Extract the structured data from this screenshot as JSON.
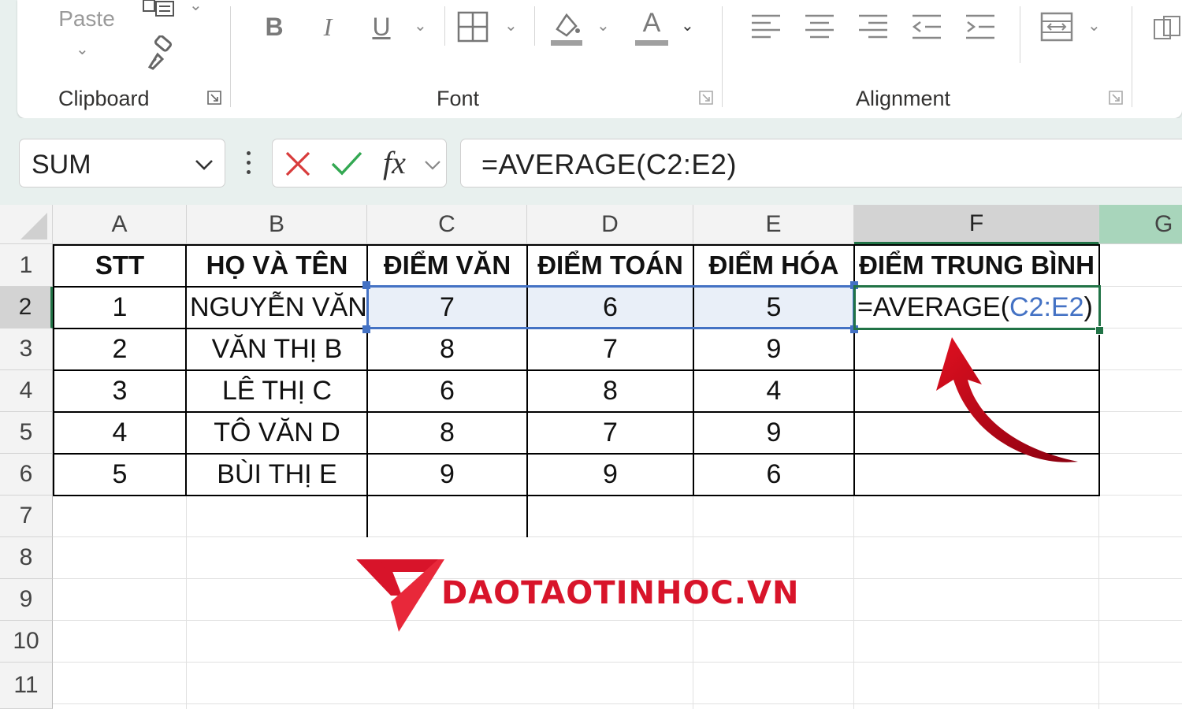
{
  "ribbon": {
    "paste_label": "Paste",
    "groups": {
      "clipboard": "Clipboard",
      "font": "Font",
      "alignment": "Alignment"
    },
    "font_buttons": {
      "bold": "B",
      "italic": "I",
      "underline": "U",
      "font_color": "A"
    }
  },
  "formula_bar": {
    "name_box": "SUM",
    "fx_label": "fx",
    "formula": "=AVERAGE(C2:E2)"
  },
  "columns": [
    "A",
    "B",
    "C",
    "D",
    "E",
    "F",
    "G"
  ],
  "rows": [
    "1",
    "2",
    "3",
    "4",
    "5",
    "6",
    "7",
    "8",
    "9",
    "10",
    "11"
  ],
  "table": {
    "headers": [
      "STT",
      "HỌ VÀ TÊN",
      "ĐIỂM VĂN",
      "ĐIỂM TOÁN",
      "ĐIỂM HÓA",
      "ĐIỂM TRUNG BÌNH"
    ],
    "rows": [
      [
        "1",
        "NGUYỄN VĂN",
        "7",
        "6",
        "5"
      ],
      [
        "2",
        "VĂN THỊ B",
        "8",
        "7",
        "9"
      ],
      [
        "3",
        "LÊ THỊ C",
        "6",
        "8",
        "4"
      ],
      [
        "4",
        "TÔ VĂN D",
        "8",
        "7",
        "9"
      ],
      [
        "5",
        "BÙI THỊ E",
        "9",
        "9",
        "6"
      ]
    ]
  },
  "active_cell": {
    "prefix": "=AVERAGE(",
    "ref": "C2:E2",
    "suffix": ")"
  },
  "watermark": "DAOTAOTINHOC.VN",
  "colors": {
    "accent_green": "#217346",
    "range_blue": "#4472c4",
    "arrow_red": "#b00010",
    "brand_red": "#d8142a"
  }
}
